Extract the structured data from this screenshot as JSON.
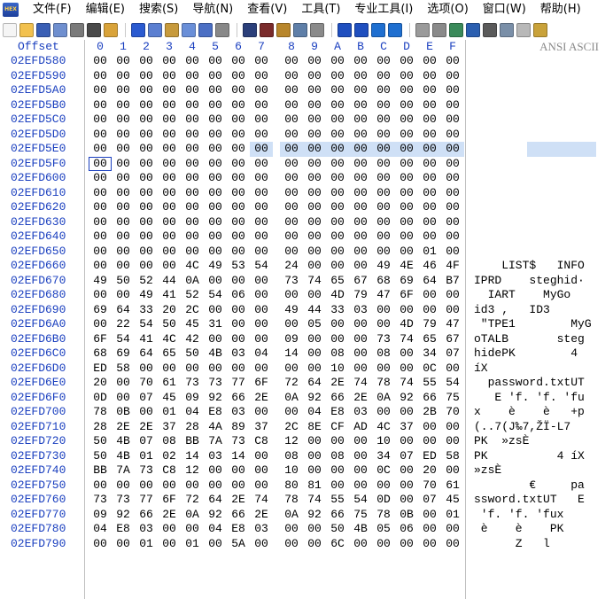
{
  "app": {
    "logo_icon": "hex-editor-logo-icon"
  },
  "menu": [
    "文件(F)",
    "编辑(E)",
    "搜索(S)",
    "导航(N)",
    "查看(V)",
    "工具(T)",
    "专业工具(I)",
    "选项(O)",
    "窗口(W)",
    "帮助(H)"
  ],
  "toolbar_groups": [
    [
      {
        "name": "new-file-icon",
        "color": "#f5f5f5"
      },
      {
        "name": "open-folder-icon",
        "color": "#f2c14e"
      },
      {
        "name": "save-icon",
        "color": "#3a5fb5"
      },
      {
        "name": "save-all-icon",
        "color": "#6f8fcf"
      },
      {
        "name": "print-icon",
        "color": "#7a7a7a"
      },
      {
        "name": "properties-icon",
        "color": "#4a4a4a"
      },
      {
        "name": "open-disk-icon",
        "color": "#d9a33a"
      }
    ],
    [
      {
        "name": "undo-icon",
        "color": "#2a5ad0"
      },
      {
        "name": "copy-icon",
        "color": "#5b7fd1"
      },
      {
        "name": "paste-icon",
        "color": "#c79a3c"
      },
      {
        "name": "copy-block-icon",
        "color": "#6a8fd8"
      },
      {
        "name": "paste-block-icon",
        "color": "#4b6fc4"
      },
      {
        "name": "fill-block-icon",
        "color": "#888888"
      }
    ],
    [
      {
        "name": "find-icon",
        "color": "#2b3f7a"
      },
      {
        "name": "find-replace-icon",
        "color": "#7a2b2b"
      },
      {
        "name": "find-hex-icon",
        "color": "#b8862b"
      },
      {
        "name": "replace-hex-icon",
        "color": "#5f7fa8"
      },
      {
        "name": "hex-search-icon",
        "color": "#8a8a8a"
      }
    ],
    [
      {
        "name": "goto-offset-icon",
        "color": "#1f4fbf"
      },
      {
        "name": "goto-sector-icon",
        "color": "#1f4fbf"
      },
      {
        "name": "back-arrow-icon",
        "color": "#1f6fd0"
      },
      {
        "name": "forward-arrow-icon",
        "color": "#1f6fd0"
      }
    ],
    [
      {
        "name": "disk-icon",
        "color": "#9a9a9a"
      },
      {
        "name": "disk-clone-icon",
        "color": "#8a8a8a"
      },
      {
        "name": "ram-editor-icon",
        "color": "#3a8a5a"
      },
      {
        "name": "calculator-icon",
        "color": "#2b5fb0"
      },
      {
        "name": "search-disk-icon",
        "color": "#5a5a5a"
      },
      {
        "name": "analyze-icon",
        "color": "#7a8fa8"
      },
      {
        "name": "template-icon",
        "color": "#b8b8b8"
      },
      {
        "name": "settings-icon",
        "color": "#c9a23a"
      }
    ]
  ],
  "editor": {
    "offset_header": "Offset",
    "ascii_header": "ANSI ASCII",
    "hex_headers": [
      "0",
      "1",
      "2",
      "3",
      "4",
      "5",
      "6",
      "7",
      "8",
      "9",
      "A",
      "B",
      "C",
      "D",
      "E",
      "F"
    ],
    "selection": {
      "hex_row": 6,
      "hex_cols": [
        7,
        8,
        9,
        10,
        11,
        12,
        13,
        14,
        15
      ],
      "ascii_row": 6,
      "ascii_start": 7,
      "ascii_len": 9,
      "cursor_row": 7,
      "cursor_col": 0
    },
    "rows": [
      {
        "offset": "02EFD580",
        "hex": [
          "00",
          "00",
          "00",
          "00",
          "00",
          "00",
          "00",
          "00",
          "00",
          "00",
          "00",
          "00",
          "00",
          "00",
          "00",
          "00"
        ],
        "ascii": ""
      },
      {
        "offset": "02EFD590",
        "hex": [
          "00",
          "00",
          "00",
          "00",
          "00",
          "00",
          "00",
          "00",
          "00",
          "00",
          "00",
          "00",
          "00",
          "00",
          "00",
          "00"
        ],
        "ascii": ""
      },
      {
        "offset": "02EFD5A0",
        "hex": [
          "00",
          "00",
          "00",
          "00",
          "00",
          "00",
          "00",
          "00",
          "00",
          "00",
          "00",
          "00",
          "00",
          "00",
          "00",
          "00"
        ],
        "ascii": ""
      },
      {
        "offset": "02EFD5B0",
        "hex": [
          "00",
          "00",
          "00",
          "00",
          "00",
          "00",
          "00",
          "00",
          "00",
          "00",
          "00",
          "00",
          "00",
          "00",
          "00",
          "00"
        ],
        "ascii": ""
      },
      {
        "offset": "02EFD5C0",
        "hex": [
          "00",
          "00",
          "00",
          "00",
          "00",
          "00",
          "00",
          "00",
          "00",
          "00",
          "00",
          "00",
          "00",
          "00",
          "00",
          "00"
        ],
        "ascii": ""
      },
      {
        "offset": "02EFD5D0",
        "hex": [
          "00",
          "00",
          "00",
          "00",
          "00",
          "00",
          "00",
          "00",
          "00",
          "00",
          "00",
          "00",
          "00",
          "00",
          "00",
          "00"
        ],
        "ascii": ""
      },
      {
        "offset": "02EFD5E0",
        "hex": [
          "00",
          "00",
          "00",
          "00",
          "00",
          "00",
          "00",
          "00",
          "00",
          "00",
          "00",
          "00",
          "00",
          "00",
          "00",
          "00"
        ],
        "ascii": ""
      },
      {
        "offset": "02EFD5F0",
        "hex": [
          "00",
          "00",
          "00",
          "00",
          "00",
          "00",
          "00",
          "00",
          "00",
          "00",
          "00",
          "00",
          "00",
          "00",
          "00",
          "00"
        ],
        "ascii": ""
      },
      {
        "offset": "02EFD600",
        "hex": [
          "00",
          "00",
          "00",
          "00",
          "00",
          "00",
          "00",
          "00",
          "00",
          "00",
          "00",
          "00",
          "00",
          "00",
          "00",
          "00"
        ],
        "ascii": ""
      },
      {
        "offset": "02EFD610",
        "hex": [
          "00",
          "00",
          "00",
          "00",
          "00",
          "00",
          "00",
          "00",
          "00",
          "00",
          "00",
          "00",
          "00",
          "00",
          "00",
          "00"
        ],
        "ascii": ""
      },
      {
        "offset": "02EFD620",
        "hex": [
          "00",
          "00",
          "00",
          "00",
          "00",
          "00",
          "00",
          "00",
          "00",
          "00",
          "00",
          "00",
          "00",
          "00",
          "00",
          "00"
        ],
        "ascii": ""
      },
      {
        "offset": "02EFD630",
        "hex": [
          "00",
          "00",
          "00",
          "00",
          "00",
          "00",
          "00",
          "00",
          "00",
          "00",
          "00",
          "00",
          "00",
          "00",
          "00",
          "00"
        ],
        "ascii": ""
      },
      {
        "offset": "02EFD640",
        "hex": [
          "00",
          "00",
          "00",
          "00",
          "00",
          "00",
          "00",
          "00",
          "00",
          "00",
          "00",
          "00",
          "00",
          "00",
          "00",
          "00"
        ],
        "ascii": ""
      },
      {
        "offset": "02EFD650",
        "hex": [
          "00",
          "00",
          "00",
          "00",
          "00",
          "00",
          "00",
          "00",
          "00",
          "00",
          "00",
          "00",
          "00",
          "00",
          "01",
          "00"
        ],
        "ascii": ""
      },
      {
        "offset": "02EFD660",
        "hex": [
          "00",
          "00",
          "00",
          "00",
          "4C",
          "49",
          "53",
          "54",
          "24",
          "00",
          "00",
          "00",
          "49",
          "4E",
          "46",
          "4F"
        ],
        "ascii": "    LIST$   INFO"
      },
      {
        "offset": "02EFD670",
        "hex": [
          "49",
          "50",
          "52",
          "44",
          "0A",
          "00",
          "00",
          "00",
          "73",
          "74",
          "65",
          "67",
          "68",
          "69",
          "64",
          "B7"
        ],
        "ascii": "IPRD    steghid·"
      },
      {
        "offset": "02EFD680",
        "hex": [
          "00",
          "00",
          "49",
          "41",
          "52",
          "54",
          "06",
          "00",
          "00",
          "00",
          "4D",
          "79",
          "47",
          "6F",
          "00",
          "00"
        ],
        "ascii": "  IART    MyGo  "
      },
      {
        "offset": "02EFD690",
        "hex": [
          "69",
          "64",
          "33",
          "20",
          "2C",
          "00",
          "00",
          "00",
          "49",
          "44",
          "33",
          "03",
          "00",
          "00",
          "00",
          "00"
        ],
        "ascii": "id3 ,   ID3     "
      },
      {
        "offset": "02EFD6A0",
        "hex": [
          "00",
          "22",
          "54",
          "50",
          "45",
          "31",
          "00",
          "00",
          "00",
          "05",
          "00",
          "00",
          "00",
          "4D",
          "79",
          "47"
        ],
        "ascii": " \"TPE1        MyG"
      },
      {
        "offset": "02EFD6B0",
        "hex": [
          "6F",
          "54",
          "41",
          "4C",
          "42",
          "00",
          "00",
          "00",
          "09",
          "00",
          "00",
          "00",
          "73",
          "74",
          "65",
          "67"
        ],
        "ascii": "oTALB       steg"
      },
      {
        "offset": "02EFD6C0",
        "hex": [
          "68",
          "69",
          "64",
          "65",
          "50",
          "4B",
          "03",
          "04",
          "14",
          "00",
          "08",
          "00",
          "08",
          "00",
          "34",
          "07"
        ],
        "ascii": "hidePK        4 "
      },
      {
        "offset": "02EFD6D0",
        "hex": [
          "ED",
          "58",
          "00",
          "00",
          "00",
          "00",
          "00",
          "00",
          "00",
          "00",
          "10",
          "00",
          "00",
          "00",
          "0C",
          "00"
        ],
        "ascii": "íX              "
      },
      {
        "offset": "02EFD6E0",
        "hex": [
          "20",
          "00",
          "70",
          "61",
          "73",
          "73",
          "77",
          "6F",
          "72",
          "64",
          "2E",
          "74",
          "78",
          "74",
          "55",
          "54"
        ],
        "ascii": "  password.txtUT"
      },
      {
        "offset": "02EFD6F0",
        "hex": [
          "0D",
          "00",
          "07",
          "45",
          "09",
          "92",
          "66",
          "2E",
          "0A",
          "92",
          "66",
          "2E",
          "0A",
          "92",
          "66",
          "75"
        ],
        "ascii": "   E 'f. 'f. 'fu"
      },
      {
        "offset": "02EFD700",
        "hex": [
          "78",
          "0B",
          "00",
          "01",
          "04",
          "E8",
          "03",
          "00",
          "00",
          "04",
          "E8",
          "03",
          "00",
          "00",
          "2B",
          "70"
        ],
        "ascii": "x    è    è   +p"
      },
      {
        "offset": "02EFD710",
        "hex": [
          "28",
          "2E",
          "2E",
          "37",
          "28",
          "4A",
          "89",
          "37",
          "2C",
          "8E",
          "CF",
          "AD",
          "4C",
          "37",
          "00",
          "00"
        ],
        "ascii": "(..7(J‰7,ŽÏ-L7  "
      },
      {
        "offset": "02EFD720",
        "hex": [
          "50",
          "4B",
          "07",
          "08",
          "BB",
          "7A",
          "73",
          "C8",
          "12",
          "00",
          "00",
          "00",
          "10",
          "00",
          "00",
          "00"
        ],
        "ascii": "PK  »zsÈ        "
      },
      {
        "offset": "02EFD730",
        "hex": [
          "50",
          "4B",
          "01",
          "02",
          "14",
          "03",
          "14",
          "00",
          "08",
          "00",
          "08",
          "00",
          "34",
          "07",
          "ED",
          "58"
        ],
        "ascii": "PK          4 íX"
      },
      {
        "offset": "02EFD740",
        "hex": [
          "BB",
          "7A",
          "73",
          "C8",
          "12",
          "00",
          "00",
          "00",
          "10",
          "00",
          "00",
          "00",
          "0C",
          "00",
          "20",
          "00"
        ],
        "ascii": "»zsÈ            "
      },
      {
        "offset": "02EFD750",
        "hex": [
          "00",
          "00",
          "00",
          "00",
          "00",
          "00",
          "00",
          "00",
          "80",
          "81",
          "00",
          "00",
          "00",
          "00",
          "70",
          "61"
        ],
        "ascii": "        €     pa"
      },
      {
        "offset": "02EFD760",
        "hex": [
          "73",
          "73",
          "77",
          "6F",
          "72",
          "64",
          "2E",
          "74",
          "78",
          "74",
          "55",
          "54",
          "0D",
          "00",
          "07",
          "45"
        ],
        "ascii": "ssword.txtUT   E"
      },
      {
        "offset": "02EFD770",
        "hex": [
          "09",
          "92",
          "66",
          "2E",
          "0A",
          "92",
          "66",
          "2E",
          "0A",
          "92",
          "66",
          "75",
          "78",
          "0B",
          "00",
          "01"
        ],
        "ascii": " 'f. 'f. 'fux   "
      },
      {
        "offset": "02EFD780",
        "hex": [
          "04",
          "E8",
          "03",
          "00",
          "00",
          "04",
          "E8",
          "03",
          "00",
          "00",
          "50",
          "4B",
          "05",
          "06",
          "00",
          "00"
        ],
        "ascii": " è    è    PK   "
      },
      {
        "offset": "02EFD790",
        "hex": [
          "00",
          "00",
          "01",
          "00",
          "01",
          "00",
          "5A",
          "00",
          "00",
          "00",
          "6C",
          "00",
          "00",
          "00",
          "00",
          "00"
        ],
        "ascii": "      Z   l     "
      }
    ]
  }
}
